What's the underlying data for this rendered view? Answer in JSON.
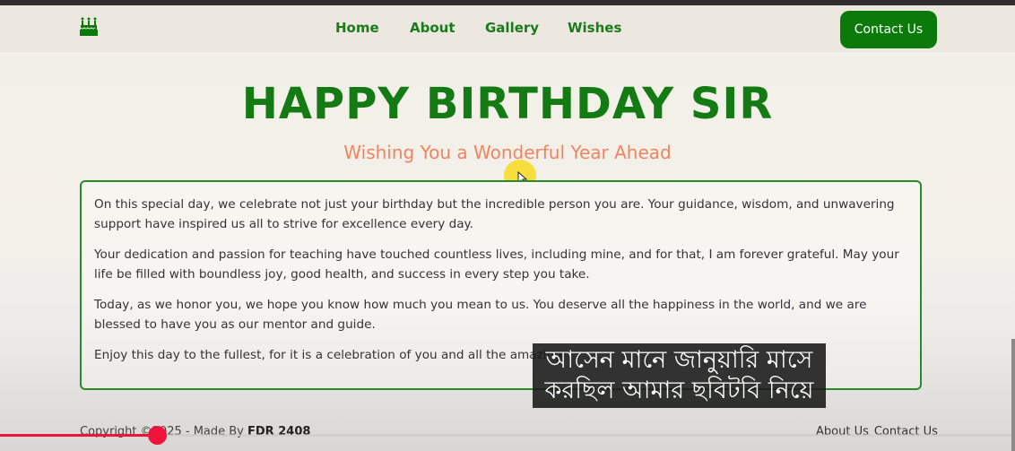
{
  "nav": {
    "logo_icon": "birthday-cake-icon",
    "links": [
      "Home",
      "About",
      "Gallery",
      "Wishes"
    ],
    "contact_button": "Contact Us"
  },
  "hero": {
    "title": "HAPPY BIRTHDAY SIR",
    "subtitle": "Wishing You a Wonderful Year Ahead"
  },
  "message": {
    "paragraphs": [
      "On this special day, we celebrate not just your birthday but the incredible person you are. Your guidance, wisdom, and unwavering support have inspired us all to strive for excellence every day.",
      "Your dedication and passion for teaching have touched countless lives, including mine, and for that, I am forever grateful. May your life be filled with boundless joy, good health, and success in every step you take.",
      "Today, as we honor you, we hope you know how much you mean to us. You deserve all the happiness in the world, and we are blessed to have you as our mentor and guide.",
      "Enjoy this day to the fullest, for it is a celebration of you and all the amazing"
    ]
  },
  "footer": {
    "copyright_prefix": "Copyright ©2025 - Made By",
    "author": "FDR 2408",
    "links": [
      "About Us",
      "Contact Us"
    ]
  },
  "video_overlay": {
    "caption_lines": [
      "আসেন মানে জানুয়ারি মাসে",
      "করছিল আমার ছবিটবি নিয়ে"
    ],
    "progress_fraction": 0.155
  },
  "colors": {
    "accent_green": "#0b7a0b",
    "subtitle_orange": "#ef8462",
    "progress_red": "#f0133b"
  }
}
